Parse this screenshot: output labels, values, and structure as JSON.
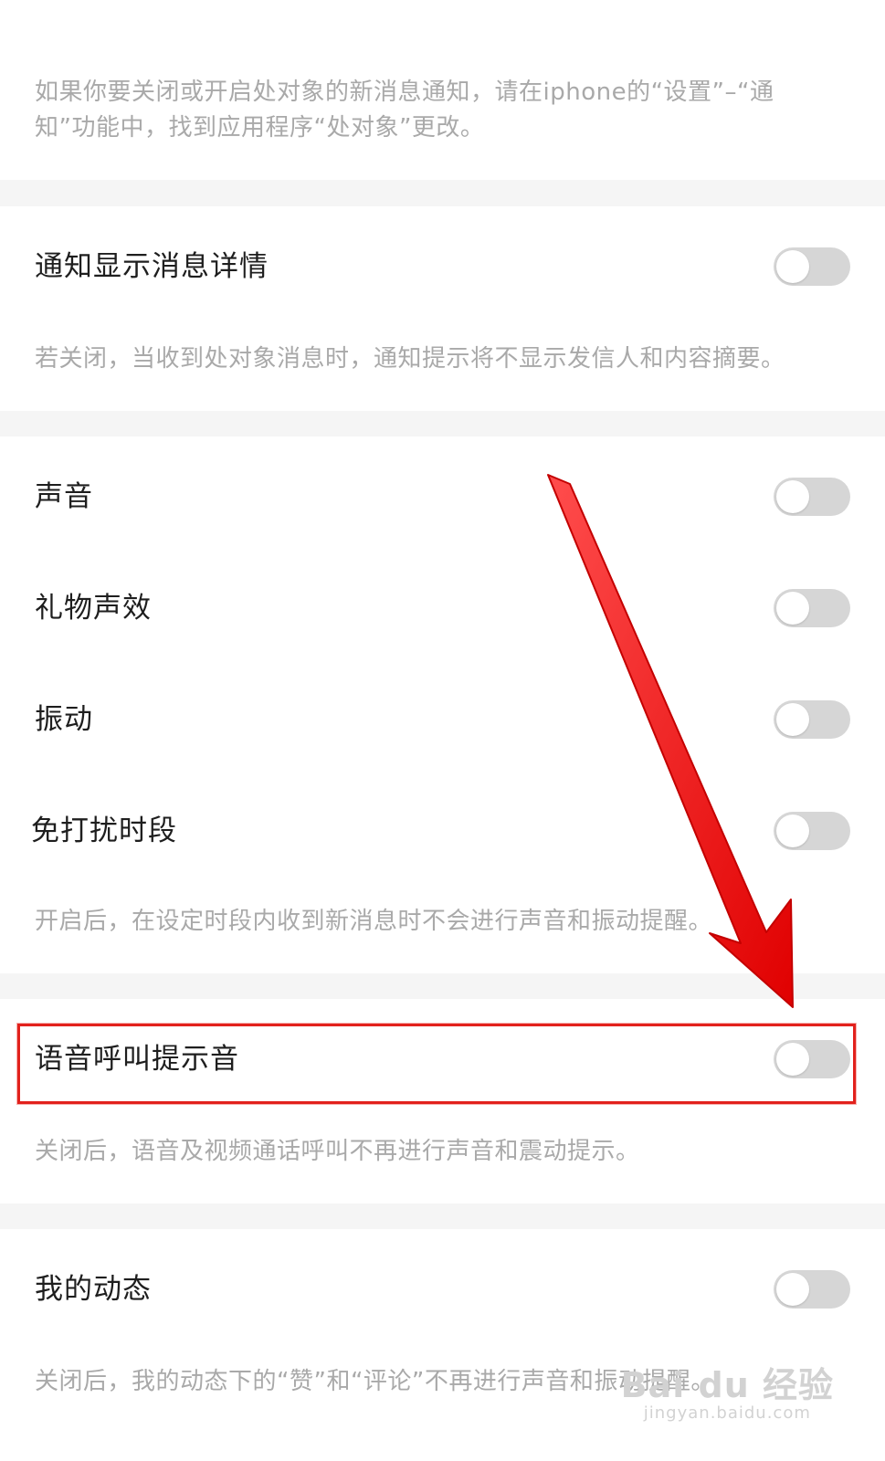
{
  "intro_note": "如果你要关闭或开启处对象的新消息通知，请在iphone的“设置”–“通知”功能中，找到应用程序“处对象”更改。",
  "sections": {
    "notify_detail": {
      "label": "通知显示消息详情",
      "enabled": false,
      "note": "若关闭，当收到处对象消息时，通知提示将不显示发信人和内容摘要。"
    },
    "sound": {
      "label": "声音",
      "enabled": false
    },
    "gift_sound": {
      "label": "礼物声效",
      "enabled": false
    },
    "vibration": {
      "label": "振动",
      "enabled": false
    },
    "dnd": {
      "label": "免打扰时段",
      "enabled": false,
      "note": "开启后，在设定时段内收到新消息时不会进行声音和振动提醒。"
    },
    "voice_call": {
      "label": "语音呼叫提示音",
      "enabled": false,
      "note": "关闭后，语音及视频通话呼叫不再进行声音和震动提示。"
    },
    "my_moments": {
      "label": "我的动态",
      "enabled": false,
      "note": "关闭后，我的动态下的“赞”和“评论”不再进行声音和振动提醒。"
    }
  },
  "colors": {
    "toggle_off": "#d6d6d6",
    "highlight": "#e2211c",
    "arrow": "#ff1a1a"
  },
  "watermark": {
    "logo": "Bai du 经验",
    "url": "jingyan.baidu.com"
  }
}
